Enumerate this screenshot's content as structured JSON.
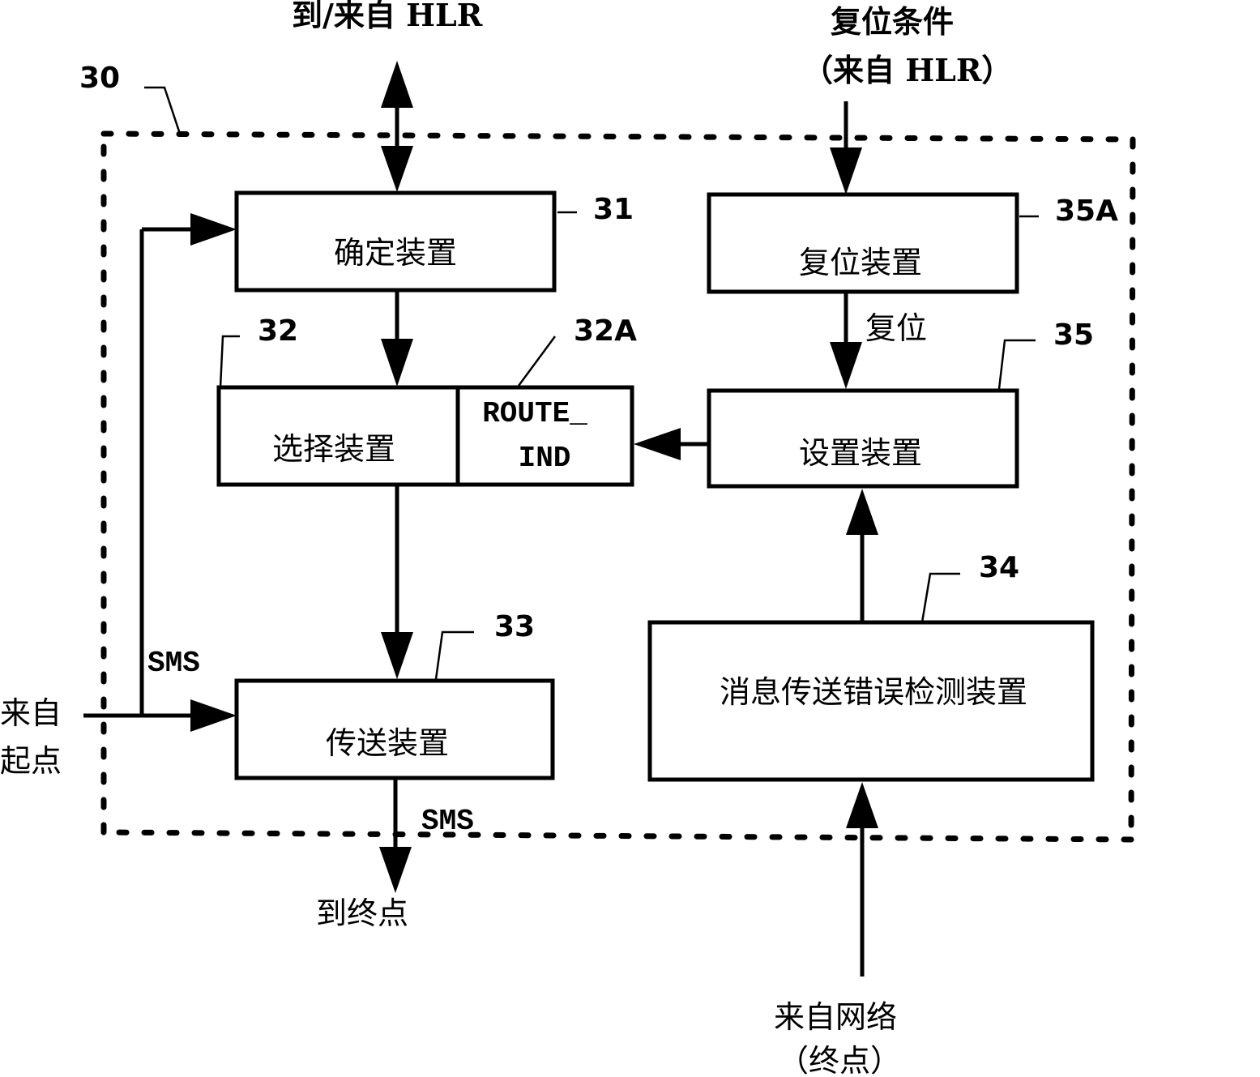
{
  "diagram": {
    "container": {
      "ref": "30"
    },
    "external": {
      "hlr_io": "到/来自 HLR",
      "reset_condition_line1": "复位条件",
      "reset_condition_line2": "（来自 HLR）",
      "from_origin_line1": "来自",
      "from_origin_line2": "起点",
      "to_destination": "到终点",
      "from_network_line1": "来自网络",
      "from_network_line2": "（终点）"
    },
    "blocks": {
      "determine": {
        "ref": "31",
        "label": "确定装置"
      },
      "select": {
        "ref": "32",
        "label": "选择装置"
      },
      "route_ind": {
        "ref": "32A",
        "label_line1": "ROUTE_",
        "label_line2": "IND"
      },
      "transmit": {
        "ref": "33",
        "label": "传送装置"
      },
      "error_detect": {
        "ref": "34",
        "label": "消息传送错误检测装置"
      },
      "set": {
        "ref": "35",
        "label": "设置装置"
      },
      "reset": {
        "ref": "35A",
        "label": "复位装置"
      }
    },
    "edge_labels": {
      "sms_in": "SMS",
      "sms_out": "SMS",
      "reset": "复位"
    }
  }
}
